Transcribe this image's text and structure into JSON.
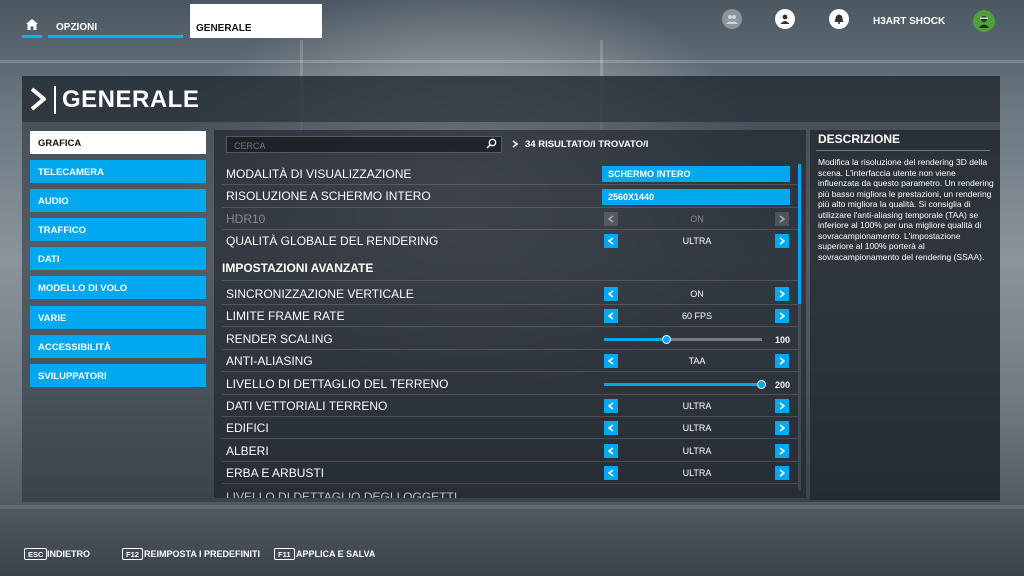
{
  "topbar": {
    "home_icon": "home-icon",
    "options_label": "OPZIONI",
    "general_label": "GENERALE",
    "user_name": "H3ART SHOCK"
  },
  "header": {
    "title": "GENERALE"
  },
  "categories": [
    {
      "label": "GRAFICA",
      "active": true
    },
    {
      "label": "TELECAMERA"
    },
    {
      "label": "AUDIO"
    },
    {
      "label": "TRAFFICO"
    },
    {
      "label": "DATI"
    },
    {
      "label": "MODELLO DI VOLO"
    },
    {
      "label": "VARIE"
    },
    {
      "label": "ACCESSIBILITÀ"
    },
    {
      "label": "SVILUPPATORI"
    }
  ],
  "search": {
    "placeholder": "CERCA",
    "results": "34 RISULTATO/I TROVATO/I"
  },
  "settings": {
    "display_mode": {
      "label": "MODALITÀ DI VISUALIZZAZIONE",
      "value": "SCHERMO INTERO"
    },
    "resolution": {
      "label": "RISOLUZIONE A SCHERMO INTERO",
      "value": "2560X1440"
    },
    "hdr": {
      "label": "HDR10",
      "value": "ON"
    },
    "quality": {
      "label": "QUALITÀ GLOBALE DEL RENDERING",
      "value": "ULTRA"
    },
    "advanced_title": "IMPOSTAZIONI AVANZATE",
    "vsync": {
      "label": "SINCRONIZZAZIONE VERTICALE",
      "value": "ON"
    },
    "frame_limit": {
      "label": "LIMITE FRAME RATE",
      "value": "60 FPS"
    },
    "render_scaling": {
      "label": "RENDER SCALING",
      "value": "100",
      "level": 0.4
    },
    "anti_aliasing": {
      "label": "ANTI-ALIASING",
      "value": "TAA"
    },
    "terrain_lod": {
      "label": "LIVELLO DI DETTAGLIO DEL TERRENO",
      "value": "200",
      "level": 1.0
    },
    "vector_data": {
      "label": "DATI VETTORIALI TERRENO",
      "value": "ULTRA"
    },
    "buildings": {
      "label": "EDIFICI",
      "value": "ULTRA"
    },
    "trees": {
      "label": "ALBERI",
      "value": "ULTRA"
    },
    "grass": {
      "label": "ERBA E ARBUSTI",
      "value": "ULTRA"
    },
    "objects_lod": {
      "label": "LIVELLO DI DETTAGLIO DEGLI OGGETTI"
    }
  },
  "description": {
    "title": "DESCRIZIONE",
    "text": "Modifica la risoluzione del rendering 3D della scena. L'interfaccia utente non viene influenzata da questo parametro. Un rendering più basso migliora le prestazioni, un rendering più alto migliora la qualità. Si consiglia di utilizzare l'anti-aliasing temporale (TAA) se inferiore al 100% per una migliore qualità di sovracampionamento. L'impostazione superiore al 100% porterà al sovracampionamento del rendering (SSAA)."
  },
  "footer": {
    "back": {
      "key": "ESC",
      "label": "INDIETRO"
    },
    "reset": {
      "key": "F12",
      "label": "REIMPOSTA I PREDEFINITI"
    },
    "apply": {
      "key": "F11",
      "label": "APPLICA E SALVA"
    }
  },
  "colors": {
    "accent": "#00a8ef",
    "active_tab": "#ffffff",
    "avatar": "#4da03a"
  }
}
